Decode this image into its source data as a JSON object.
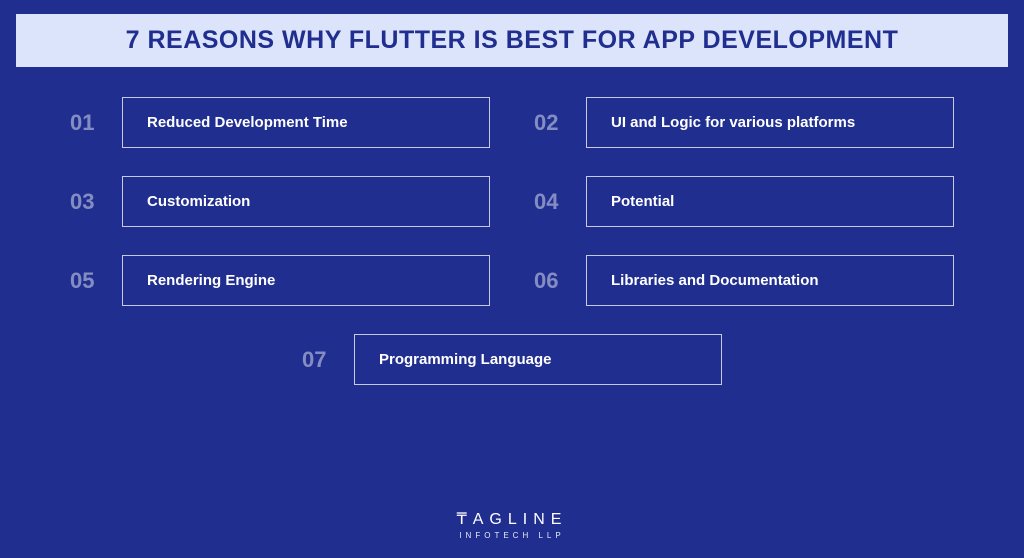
{
  "title": "7 REASONS WHY FLUTTER IS BEST FOR APP DEVELOPMENT",
  "reasons": [
    {
      "num": "01",
      "label": "Reduced Development Time"
    },
    {
      "num": "02",
      "label": "UI and Logic for various platforms"
    },
    {
      "num": "03",
      "label": "Customization"
    },
    {
      "num": "04",
      "label": "Potential"
    },
    {
      "num": "05",
      "label": "Rendering Engine"
    },
    {
      "num": "06",
      "label": "Libraries and Documentation"
    },
    {
      "num": "07",
      "label": "Programming Language"
    }
  ],
  "logo": {
    "brand": "₸AGLINE",
    "sub": "INFOTECH LLP"
  }
}
